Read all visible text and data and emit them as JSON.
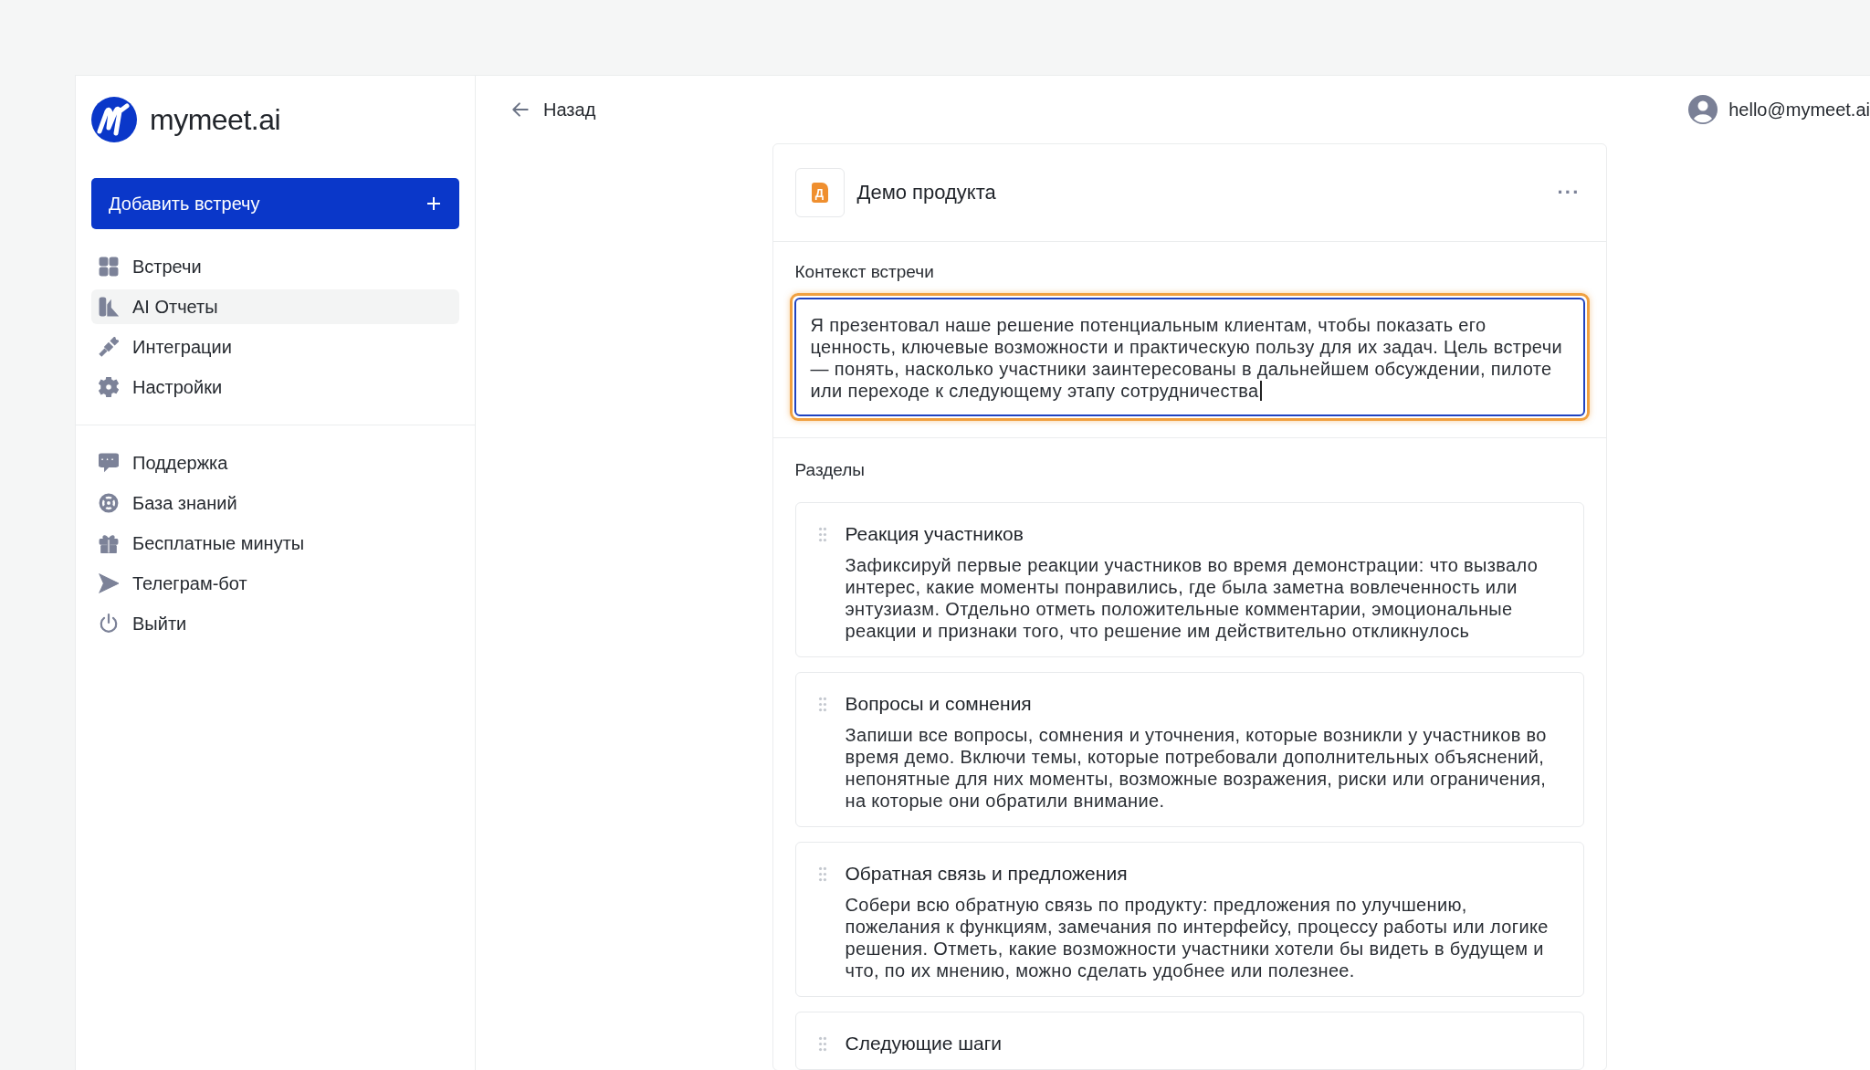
{
  "brand": {
    "name": "mymeet.ai"
  },
  "add_button": {
    "label": "Добавить встречу"
  },
  "nav_primary": [
    {
      "label": "Встречи",
      "kind": "grid",
      "selected": false
    },
    {
      "label": "AI Отчеты",
      "kind": "report",
      "selected": true
    },
    {
      "label": "Интеграции",
      "kind": "plug",
      "selected": false
    },
    {
      "label": "Настройки",
      "kind": "gear",
      "selected": false
    }
  ],
  "nav_secondary": [
    {
      "label": "Поддержка",
      "kind": "chat",
      "selected": false
    },
    {
      "label": "База знаний",
      "kind": "lifebuoy",
      "selected": false
    },
    {
      "label": "Бесплатные минуты",
      "kind": "gift",
      "selected": false
    },
    {
      "label": "Телеграм-бот",
      "kind": "send",
      "selected": false
    },
    {
      "label": "Выйти",
      "kind": "power",
      "selected": false
    }
  ],
  "back": {
    "label": "Назад"
  },
  "user": {
    "email": "hello@mymeet.ai"
  },
  "report": {
    "badge": "Д",
    "title": "Демо продукта",
    "menu": "···",
    "context_label": "Контекст встречи",
    "context_value": "Я презентовал наше решение потенциальным клиентам, чтобы показать его ценность, ключевые возможности и практическую пользу для их задач. Цель встречи — понять, насколько участники заинтересованы в дальнейшем обсуждении, пилоте или переходе к следующему этапу сотрудничества",
    "context_focused": true,
    "sections_label": "Разделы",
    "sections": [
      {
        "title": "Реакция участников",
        "description": "Зафиксируй первые реакции участников во время демонстрации: что вызвало интерес, какие моменты понравились, где была заметна вовлеченность или энтузиазм. Отдельно отметь положительные комментарии, эмоциональные реакции и признаки того, что решение им действительно откликнулось"
      },
      {
        "title": "Вопросы и сомнения",
        "description": "Запиши все вопросы, сомнения и уточнения, которые возникли у участников во время демо. Включи темы, которые потребовали дополнительных объяснений, непонятные для них моменты, возможные возражения, риски или ограничения, на которые они обратили внимание."
      },
      {
        "title": "Обратная связь и предложения",
        "description": "Собери всю обратную связь по продукту: предложения по улучшению, пожелания к функциям, замечания по интерфейсу, процессу работы или логике решения. Отметь, какие возможности участники хотели бы видеть в будущем и что, по их мнению, можно сделать удобнее или полезнее."
      },
      {
        "title": "Следующие шаги"
      }
    ]
  }
}
